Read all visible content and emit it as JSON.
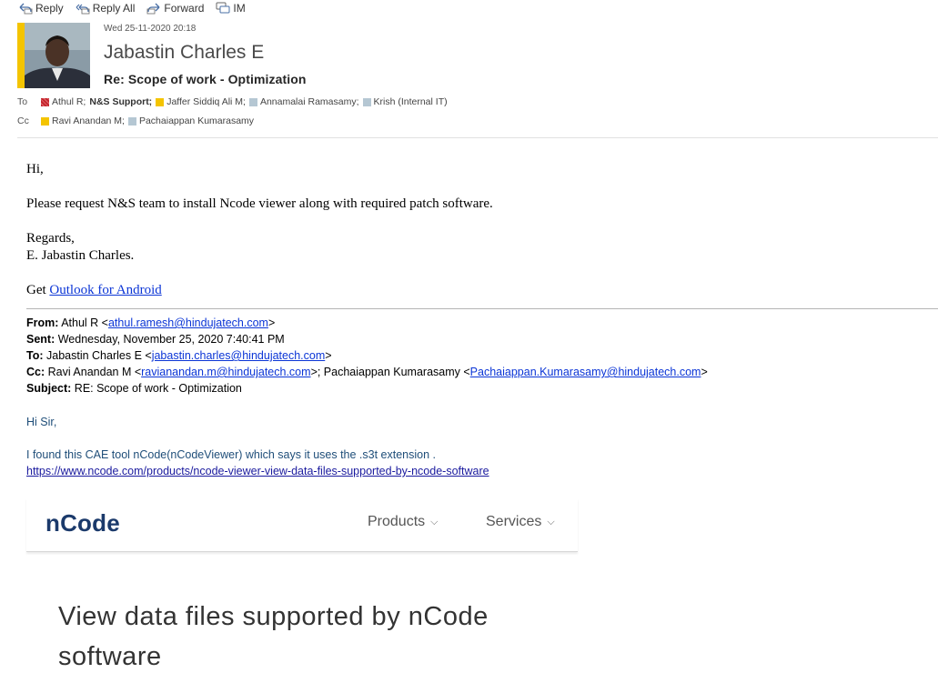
{
  "toolbar": {
    "reply_label": "Reply",
    "reply_all_label": "Reply All",
    "forward_label": "Forward",
    "im_label": "IM"
  },
  "message": {
    "date": "Wed 25-11-2020 20:18",
    "sender": "Jabastin Charles E",
    "subject": "Re: Scope of work - Optimization",
    "to_label": "To",
    "cc_label": "Cc",
    "to": [
      {
        "name": "Athul R;",
        "color": "red"
      },
      {
        "name": "N&S Support;",
        "color": "none",
        "bold": true
      },
      {
        "name": "Jaffer Siddiq Ali M;",
        "color": "yellow"
      },
      {
        "name": "Annamalai Ramasamy;",
        "color": "grey"
      },
      {
        "name": "Krish (Internal IT)",
        "color": "grey"
      }
    ],
    "cc": [
      {
        "name": "Ravi Anandan M;",
        "color": "yellow"
      },
      {
        "name": "Pachaiappan Kumarasamy",
        "color": "grey"
      }
    ]
  },
  "body": {
    "greeting": "Hi,",
    "request": "Please request N&S team to install Ncode viewer along with required patch software.",
    "regards": "Regards,",
    "signature": "E. Jabastin Charles.",
    "get_prefix": "Get ",
    "get_link": "Outlook for Android"
  },
  "original": {
    "from_label": "From:",
    "from_name": " Athul R <",
    "from_email": "athul.ramesh@hindujatech.com",
    "close": ">",
    "sent_label": "Sent:",
    "sent_value": " Wednesday, November 25, 2020 7:40:41 PM",
    "to_label": "To:",
    "to_name": " Jabastin Charles E <",
    "to_email": "jabastin.charles@hindujatech.com",
    "cc_label": "Cc:",
    "cc_name1": " Ravi Anandan M <",
    "cc_email1": "ravianandan.m@hindujatech.com",
    "cc_mid": ">; Pachaiappan Kumarasamy <",
    "cc_email2": "Pachaiappan.Kumarasamy@hindujatech.com",
    "subject_label": "Subject:",
    "subject_value": " RE: Scope of work - Optimization",
    "greeting": "Hi Sir,",
    "found_text": "I found this CAE tool nCode(nCodeViewer) which says it uses the .s3t extension .",
    "url": "https://www.ncode.com/products/ncode-viewer-view-data-files-supported-by-ncode-software"
  },
  "ncode_page": {
    "logo": "nCode",
    "nav": [
      "Products",
      "Services"
    ],
    "chevron": "⌵",
    "heading": "View data files supported by nCode software"
  },
  "colors": {
    "accent_yellow": "#f4c400",
    "link_blue": "#0b35d6",
    "quote_blue": "#1f4e79",
    "ncode_navy": "#1b3a6b"
  }
}
